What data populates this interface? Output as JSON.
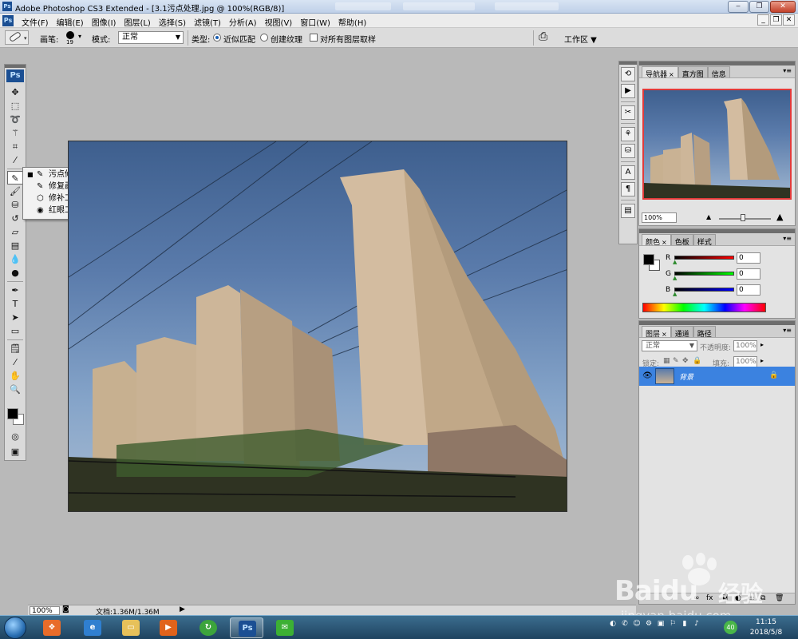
{
  "window": {
    "title": "Adobe Photoshop CS3 Extended - [3.1污点处理.jpg @ 100%(RGB/8)]",
    "app_icon": "Ps",
    "controls": [
      "_",
      "❐",
      "✕"
    ]
  },
  "menu": {
    "items": [
      "文件(F)",
      "编辑(E)",
      "图像(I)",
      "图层(L)",
      "选择(S)",
      "滤镜(T)",
      "分析(A)",
      "视图(V)",
      "窗口(W)",
      "帮助(H)"
    ],
    "doc_controls": [
      "_",
      "❐",
      "✕"
    ]
  },
  "options": {
    "brush_label": "画笔:",
    "brush_size": "19",
    "mode_label": "模式:",
    "mode_value": "正常",
    "type_label": "类型:",
    "radio1": "近似匹配",
    "radio2": "创建纹理",
    "check_all_layers": "对所有图层取样",
    "workspace": "工作区 ▼"
  },
  "toolbox": {
    "logo": "Ps"
  },
  "flyout": {
    "items": [
      {
        "label": "污点修复画笔工具",
        "key": "J",
        "selected": true
      },
      {
        "label": "修复画笔工具",
        "key": "J",
        "selected": false
      },
      {
        "label": "修补工具",
        "key": "J",
        "selected": false
      },
      {
        "label": "红眼工具",
        "key": "J",
        "selected": false
      }
    ]
  },
  "navigator": {
    "tabs": [
      "导航器",
      "直方图",
      "信息"
    ],
    "zoom": "100%"
  },
  "color": {
    "tabs": [
      "颜色",
      "色板",
      "样式"
    ],
    "r_label": "R",
    "g_label": "G",
    "b_label": "B",
    "r": "0",
    "g": "0",
    "b": "0"
  },
  "layers": {
    "tabs": [
      "图层",
      "通道",
      "路径"
    ],
    "blend": "正常",
    "opacity_label": "不透明度:",
    "opacity": "100%",
    "lock_label": "锁定:",
    "fill_label": "填充:",
    "fill": "100%",
    "layer_name": "背景"
  },
  "status": {
    "zoom": "100%",
    "doc": "文档:1.36M/1.36M"
  },
  "taskbar": {
    "time": "11:15",
    "date": "2018/5/8",
    "badge": "40",
    "ps_label": "Ps"
  },
  "watermark": {
    "brand_cn": "经验",
    "brand": "Baidu",
    "url": "jingyan.baidu.com"
  }
}
